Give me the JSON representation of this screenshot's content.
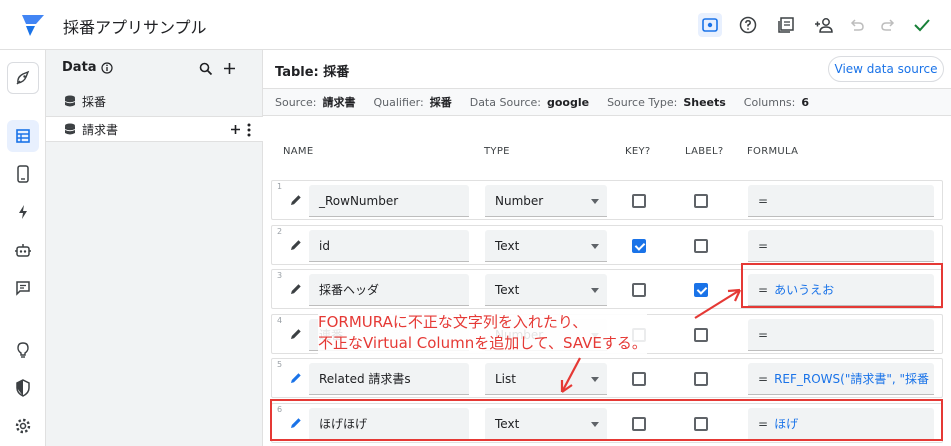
{
  "app": {
    "title": "採番アプリサンプル"
  },
  "header_icons": [
    "eye-icon",
    "help-icon",
    "gallery-icon",
    "share-user-icon",
    "undo-icon",
    "redo-icon",
    "save-check-icon"
  ],
  "rail_icons": [
    "launch-icon",
    "data-table-icon",
    "mobile-icon",
    "flash-icon",
    "bot-icon",
    "chat-icon",
    "bulb-icon",
    "shield-icon",
    "settings-icon"
  ],
  "datapanel": {
    "title": "Data",
    "items": [
      {
        "label": "採番"
      },
      {
        "label": "請求書"
      }
    ]
  },
  "main": {
    "table_title": "Table: 採番",
    "view_button": "View data source",
    "info": {
      "source_label": "Source:",
      "source": "請求書",
      "qualifier_label": "Qualifier:",
      "qualifier": "採番",
      "datasource_label": "Data Source:",
      "datasource": "google",
      "sourcetype_label": "Source Type:",
      "sourcetype": "Sheets",
      "columns_label": "Columns:",
      "columns": "6"
    },
    "column_headers": {
      "name": "NAME",
      "type": "TYPE",
      "key": "KEY?",
      "label": "LABEL?",
      "formula": "FORMULA"
    },
    "rows": [
      {
        "num": "1",
        "name": "_RowNumber",
        "type": "Number",
        "key": false,
        "label": false,
        "eq": "=",
        "formula": ""
      },
      {
        "num": "2",
        "name": "id",
        "type": "Text",
        "key": true,
        "label": false,
        "eq": "=",
        "formula": ""
      },
      {
        "num": "3",
        "name": "採番ヘッダ",
        "type": "Text",
        "key": false,
        "label": true,
        "eq": "=",
        "formula": "あいうえお"
      },
      {
        "num": "4",
        "name": "連番",
        "type": "Number",
        "key": false,
        "label": false,
        "eq": "=",
        "formula": ""
      },
      {
        "num": "5",
        "name": "Related 請求書s",
        "type": "List",
        "key": false,
        "label": false,
        "eq": "=",
        "formula": "REF_ROWS(\"請求書\", \"採番"
      },
      {
        "num": "6",
        "name": "ほげほげ",
        "type": "Text",
        "key": false,
        "label": false,
        "eq": "=",
        "formula": "ほげ"
      }
    ]
  },
  "annotation": {
    "line1": "FORMURAに不正な文字列を入れたり、",
    "line2": "不正なVirtual Columnを追加して、SAVEする。",
    "color": "#e53935"
  }
}
